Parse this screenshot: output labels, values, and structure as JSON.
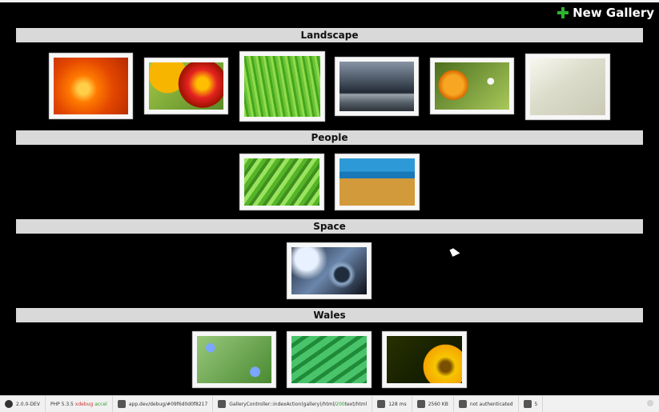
{
  "header": {
    "new_gallery_label": "New Gallery"
  },
  "galleries": [
    {
      "title": "Landscape",
      "images": [
        {
          "name": "orange-flower",
          "bg": "radial-gradient(circle at 40% 55%, #ffcf4a 0 10%, #ff7a00 25%, #e34700 55%, #b52a00 100%)"
        },
        {
          "name": "red-flower",
          "bg": "radial-gradient(circle at 72% 45%, #ffbf00 0 10%, #e52421 24%, #9d1200 40%, transparent 41%), radial-gradient(circle at 25% 25%, #f8b500 0 28%, transparent 29%), linear-gradient(135deg, #a3c949, #5b8a27)"
        },
        {
          "name": "green-grass",
          "bg": "repeating-linear-gradient(80deg, #8fdc4a 0 3px, #43a61d 3px 6px, #6ec338 6px 9px)"
        },
        {
          "name": "storm-sea",
          "bg": "linear-gradient(to bottom, #8794a5 0%, #3f4a57 45%, #202833 63%, #9aa4ac 66%, #59626a 82%, #2c3138 100%)"
        },
        {
          "name": "dandelion",
          "bg": "radial-gradient(circle at 75% 40%, #f6f6f6 0 5%, transparent 6%), radial-gradient(circle at 25% 48%, #f6a623 0 16%, #d96a00 24%, transparent 25%), linear-gradient(135deg, #4d6f1e, #a8c85a)"
        },
        {
          "name": "pale-field",
          "bg": "linear-gradient(145deg, #f7f7ef, #dcdccb 45%, #c9c9b6 100%)"
        }
      ]
    },
    {
      "title": "People",
      "images": [
        {
          "name": "leaf-closeup",
          "bg": "repeating-linear-gradient(125deg, #9ae35f 0 5px, #55b527 5px 10px, #3f8e1f 10px 14px)"
        },
        {
          "name": "beach-grass",
          "bg": "linear-gradient(to bottom, #2d9ad7 0 28%, #1878b8 28% 42%, #d29a3b 42% 100%)"
        }
      ]
    },
    {
      "title": "Space",
      "images": [
        {
          "name": "water-drop",
          "bg": "radial-gradient(circle at 67% 58%, #1e2c3c 0 12%, #8ea9c9 16%, transparent 24%), radial-gradient(circle at 20% 25%, #e8f1ff 0 16%, transparent 30%), linear-gradient(135deg, #1a2532, #6b86ab 50%, #0d1018)"
        }
      ]
    },
    {
      "title": "Wales",
      "images": [
        {
          "name": "forget-me-not",
          "bg": "radial-gradient(circle at 18% 25%, #7aa6ff 0 6%, transparent 7%), radial-gradient(circle at 78% 76%, #7aa6ff 0 7%, transparent 8%), linear-gradient(135deg, #98c87b, #4a8a32)"
        },
        {
          "name": "wet-leaf",
          "bg": "repeating-linear-gradient(145deg, #4ac46a 0 8px, #1f8b3a 8px 13px), linear-gradient(#2aa84a, #0f5f23)"
        },
        {
          "name": "yellow-daisy",
          "bg": "radial-gradient(circle at 78% 65%, #7a4f00 0 8%, #f7c600 15%, #f4a400 33%, transparent 34%), linear-gradient(135deg, #273000, #0a1400)"
        }
      ]
    }
  ],
  "toolbar": {
    "symfony_version": "2.0.0-DEV",
    "php_prefix": "PHP 5.3.5",
    "php_xdebug": "xdebug",
    "php_accel": "accel",
    "token": "app.dev/debug/#09f6d0d0f8217",
    "route": "GalleryController::indexAction(gallery)/html/",
    "route_status": "200",
    "route_suffix": "text/html",
    "time": "128 ms",
    "memory": "2560 KB",
    "auth": "not authenticated",
    "queries": "5"
  }
}
